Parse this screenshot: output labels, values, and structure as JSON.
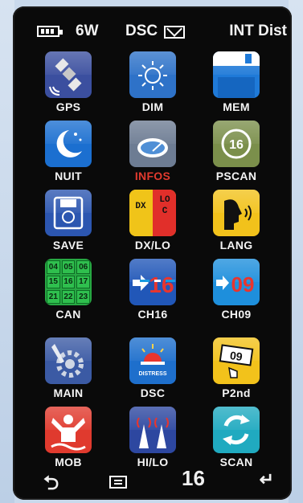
{
  "status": {
    "power": "6W",
    "dsc": "DSC",
    "mode": "INT Dist"
  },
  "tiles": [
    {
      "label": "GPS"
    },
    {
      "label": "DIM"
    },
    {
      "label": "MEM"
    },
    {
      "label": "NUIT"
    },
    {
      "label": "INFOS"
    },
    {
      "label": "PSCAN",
      "icon_text": "16"
    },
    {
      "label": "SAVE"
    },
    {
      "label": "DX/LO",
      "left_text": "DX",
      "right_text": "LOC"
    },
    {
      "label": "LANG"
    },
    {
      "label": "CAN",
      "cells": [
        "04",
        "05",
        "06",
        "15",
        "16",
        "17",
        "21",
        "22",
        "23"
      ]
    },
    {
      "label": "CH16",
      "icon_text": "16"
    },
    {
      "label": "CH09",
      "icon_text": "09"
    },
    {
      "label": "MAIN"
    },
    {
      "label": "DSC",
      "icon_text": "DISTRESS"
    },
    {
      "label": "P2nd",
      "icon_text": "09"
    },
    {
      "label": "MOB"
    },
    {
      "label": "HI/LO"
    },
    {
      "label": "SCAN"
    }
  ],
  "bottom": {
    "channel": "16"
  },
  "colors": {
    "infos_label": "#e23a2e",
    "selection": "#1a9be0"
  }
}
